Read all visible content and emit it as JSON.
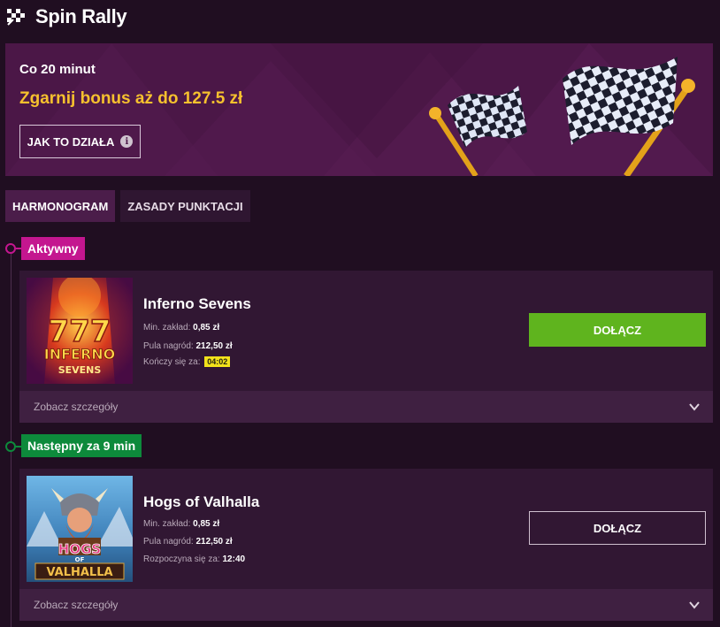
{
  "header": {
    "title": "Spin Rally"
  },
  "banner": {
    "frequency": "Co 20 minut",
    "bonus": "Zgarnij bonus aż do 127.5 zł",
    "how_button": "JAK TO DZIAŁA",
    "info_glyph": "i"
  },
  "tabs": [
    {
      "label": "HARMONOGRAM",
      "active": true
    },
    {
      "label": "ZASADY PUNKTACJI",
      "active": false
    }
  ],
  "tournaments": [
    {
      "status": "Aktywny",
      "status_color": "#c4168f",
      "game": "Inferno Sevens",
      "min_bet_label": "Min. zakład:",
      "min_bet": "0,85 zł",
      "prize_label": "Pula nagród:",
      "prize": "212,50 zł",
      "time_label": "Kończy się za:",
      "time": "04:02",
      "join": "DOŁĄCZ",
      "details": "Zobacz szczegóły",
      "thumb_text": {
        "top": "INFERNO",
        "bottom": "SEVENS",
        "sevens": "777"
      }
    },
    {
      "status": "Następny za 9 min",
      "status_color": "#0d8a3b",
      "game": "Hogs of Valhalla",
      "min_bet_label": "Min. zakład:",
      "min_bet": "0,85 zł",
      "prize_label": "Pula nagród:",
      "prize": "212,50 zł",
      "time_label": "Rozpoczyna się za:",
      "time": "12:40",
      "join": "DOŁĄCZ",
      "details": "Zobacz szczegóły",
      "thumb_text": {
        "top": "HOGS",
        "middle": "OF",
        "bottom": "VALHALLA"
      }
    }
  ],
  "colors": {
    "accent_green": "#5fb41e",
    "bonus_gold": "#f6c12e",
    "timer_yellow": "#f2e21b",
    "banner_bg": "#4b1747"
  },
  "icons": [
    "checkered-flag-icon",
    "info-icon",
    "chevron-down-icon"
  ]
}
